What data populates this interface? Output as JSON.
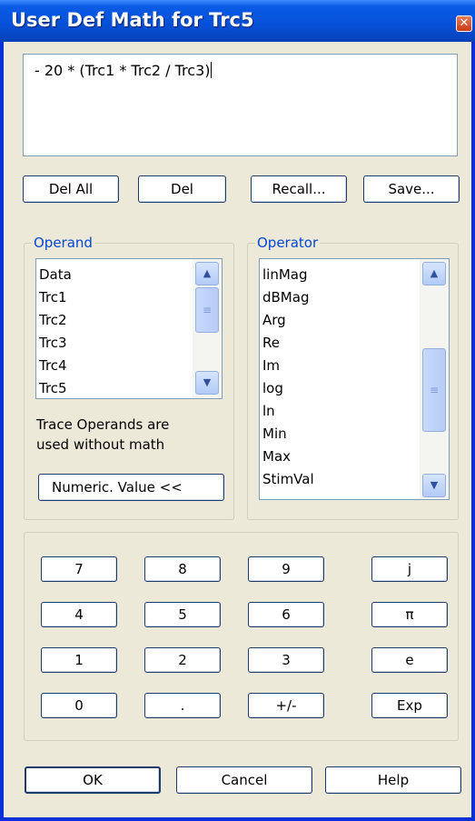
{
  "window": {
    "title": "User Def Math for Trc5",
    "close_glyph": "✕"
  },
  "expression": {
    "value": "- 20 * (Trc1 * Trc2 / Trc3)"
  },
  "edit_buttons": {
    "del_all": "Del All",
    "del": "Del",
    "recall": "Recall...",
    "save": "Save..."
  },
  "operand": {
    "title": "Operand",
    "items": [
      "Data",
      "Trc1",
      "Trc2",
      "Trc3",
      "Trc4",
      "Trc5"
    ],
    "note_line1": "Trace Operands are",
    "note_line2": "used without math",
    "numeric_button": "Numeric. Value <<"
  },
  "operator": {
    "title": "Operator",
    "items": [
      "linMag",
      "dBMag",
      "Arg",
      "Re",
      "Im",
      "log",
      "ln",
      "Min",
      "Max",
      "StimVal"
    ]
  },
  "scroll_glyphs": {
    "up": "▲",
    "down": "▼",
    "grip": "≡"
  },
  "keypad": {
    "k7": "7",
    "k8": "8",
    "k9": "9",
    "kj": "j",
    "k4": "4",
    "k5": "5",
    "k6": "6",
    "kpi": "π",
    "k1": "1",
    "k2": "2",
    "k3": "3",
    "ke": "e",
    "k0": "0",
    "kdot": ".",
    "kpm": "+/-",
    "kexp": "Exp"
  },
  "dialog_buttons": {
    "ok": "OK",
    "cancel": "Cancel",
    "help": "Help"
  }
}
